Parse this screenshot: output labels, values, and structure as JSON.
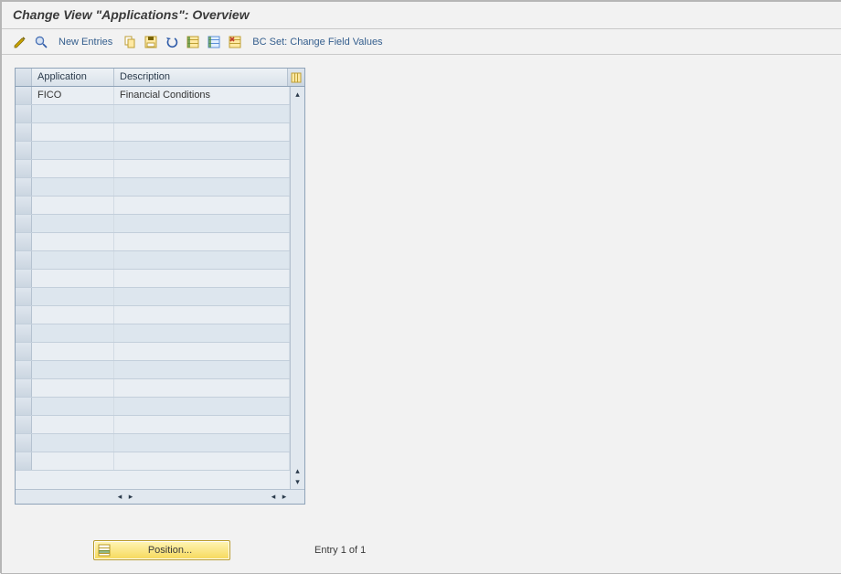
{
  "title": "Change View \"Applications\": Overview",
  "toolbar": {
    "new_entries_label": "New Entries",
    "bc_set_label": "BC Set: Change Field Values",
    "icons": {
      "toggle": "toggle-display-change-icon",
      "find": "find-icon",
      "copy": "copy-icon",
      "save": "save-icon",
      "undo": "undo-icon",
      "select_all": "select-all-icon",
      "deselect_all": "deselect-all-icon",
      "delete": "delete-icon"
    }
  },
  "table": {
    "headers": {
      "application": "Application",
      "description": "Description"
    },
    "rows": [
      {
        "application": "FICO",
        "description": "Financial Conditions"
      },
      {
        "application": "",
        "description": ""
      },
      {
        "application": "",
        "description": ""
      },
      {
        "application": "",
        "description": ""
      },
      {
        "application": "",
        "description": ""
      },
      {
        "application": "",
        "description": ""
      },
      {
        "application": "",
        "description": ""
      },
      {
        "application": "",
        "description": ""
      },
      {
        "application": "",
        "description": ""
      },
      {
        "application": "",
        "description": ""
      },
      {
        "application": "",
        "description": ""
      },
      {
        "application": "",
        "description": ""
      },
      {
        "application": "",
        "description": ""
      },
      {
        "application": "",
        "description": ""
      },
      {
        "application": "",
        "description": ""
      },
      {
        "application": "",
        "description": ""
      },
      {
        "application": "",
        "description": ""
      },
      {
        "application": "",
        "description": ""
      },
      {
        "application": "",
        "description": ""
      },
      {
        "application": "",
        "description": ""
      },
      {
        "application": "",
        "description": ""
      }
    ]
  },
  "footer": {
    "position_label": "Position...",
    "entry_count": "Entry 1 of 1"
  }
}
